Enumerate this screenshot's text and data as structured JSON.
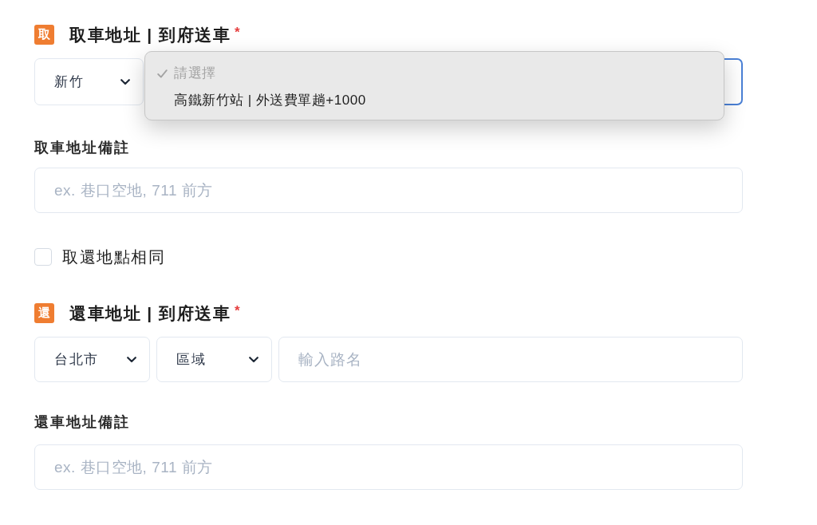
{
  "pickup": {
    "badge": "取",
    "title": "取車地址 | 到府送車",
    "required_mark": "*",
    "address_fields": [
      {
        "kind": "select",
        "value": "新竹",
        "focused": false,
        "open": false
      },
      {
        "kind": "select",
        "focused": true,
        "open": true,
        "options": [
          {
            "label": "請選擇",
            "selected": true,
            "disabled": true
          },
          {
            "label": "高鐵新竹站 | 外送費單趟+1000",
            "selected": false,
            "disabled": false
          }
        ]
      }
    ],
    "note_label": "取車地址備註",
    "note_field": {
      "placeholder": "ex. 巷口空地, 711 前方"
    }
  },
  "same_location": {
    "label": "取還地點相同",
    "checked": false
  },
  "return": {
    "badge": "還",
    "title": "還車地址 | 到府送車",
    "required_mark": "*",
    "address_fields": [
      {
        "kind": "select",
        "value": "台北市",
        "focused": false,
        "open": false
      },
      {
        "kind": "select",
        "value": "區域",
        "focused": false,
        "open": false
      },
      {
        "kind": "text",
        "placeholder": "輸入路名",
        "focused": false
      }
    ],
    "note_label": "還車地址備註",
    "note_field": {
      "placeholder": "ex. 巷口空地, 711 前方"
    }
  }
}
